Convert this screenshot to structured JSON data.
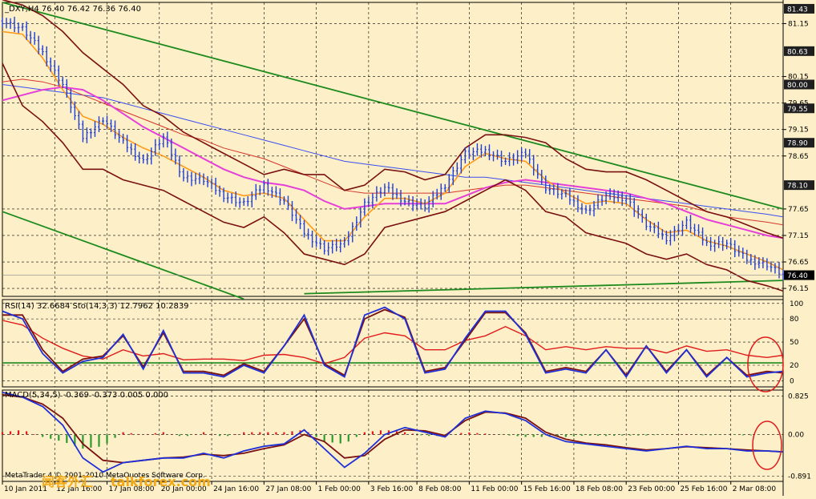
{
  "colors": {
    "background": "#fdf0c8",
    "price": "#1f3fd8",
    "price_up": "#1f3fd8",
    "price_down": "#1f3fd8",
    "fast_ma": "#ff9a1a",
    "fast_ma2": "#1ed1f0",
    "magenta_ma": "#e63fd9",
    "blue_ma": "#3a4df0",
    "red_ma": "#d6352a",
    "bollinger": "#7a1010",
    "trend_line": "#1d8a1d",
    "rsi": "#e11b1b",
    "stoch": "#1f2fd8",
    "stoch_signal": "#7a1010",
    "macd_pos": "#e11b1b",
    "macd_neg": "#2a9a2a",
    "grid": "#000000",
    "annotation_circle": "#e11b1b",
    "watermark": "#f2a915"
  },
  "chart_data": [
    {
      "type": "line",
      "panel": "price",
      "title": "_DXY,H4  76.40  76.42  76.36  76.40",
      "ylim": [
        76.0,
        81.55
      ],
      "y_tick_labels": [
        "81.15",
        "80.15",
        "79.65",
        "79.15",
        "78.65",
        "77.65",
        "77.15",
        "76.65",
        "76.15"
      ],
      "price_badges": [
        "81.43",
        "80.63",
        "80.00",
        "79.55",
        "78.90",
        "78.10",
        "76.40"
      ],
      "price_badge_values": [
        81.43,
        80.63,
        80.0,
        79.55,
        78.9,
        78.1,
        76.4
      ],
      "x_tick_labels": [
        "10 Jan 2011",
        "12 Jan 16:00",
        "17 Jan 08:00",
        "20 Jan 00:00",
        "24 Jan 16:00",
        "27 Jan 08:00",
        "1 Feb 00:00",
        "3 Feb 16:00",
        "8 Feb 08:00",
        "11 Feb 00:00",
        "15 Feb 16:00",
        "18 Feb 08:00",
        "23 Feb 00:00",
        "25 Feb 16:00",
        "2 Mar 08:00"
      ],
      "x_bar_count": 195,
      "series": [
        {
          "role": "close",
          "x": [
            0,
            5,
            10,
            15,
            20,
            25,
            30,
            35,
            40,
            45,
            50,
            55,
            60,
            65,
            70,
            75,
            80,
            85,
            90,
            95,
            100,
            105,
            110,
            115,
            120,
            125,
            130,
            135,
            140,
            145,
            150,
            155,
            160,
            165,
            170,
            175,
            180,
            185,
            190,
            194
          ],
          "values": [
            81.2,
            81.05,
            80.6,
            80.0,
            79.0,
            79.35,
            78.9,
            78.55,
            79.0,
            78.25,
            78.2,
            77.9,
            77.75,
            78.1,
            77.8,
            77.2,
            76.9,
            77.0,
            77.75,
            78.05,
            77.8,
            77.7,
            78.1,
            78.7,
            78.75,
            78.55,
            78.7,
            78.05,
            77.9,
            77.6,
            77.9,
            77.85,
            77.35,
            77.1,
            77.4,
            77.0,
            77.0,
            76.7,
            76.6,
            76.4
          ]
        },
        {
          "role": "fast_ma",
          "values": [
            81.0,
            80.95,
            80.5,
            79.9,
            79.4,
            79.25,
            79.0,
            78.8,
            78.65,
            78.45,
            78.25,
            78.0,
            77.9,
            77.95,
            77.85,
            77.45,
            77.05,
            77.05,
            77.5,
            77.85,
            77.85,
            77.75,
            77.95,
            78.45,
            78.7,
            78.6,
            78.55,
            78.2,
            77.95,
            77.75,
            77.8,
            77.75,
            77.45,
            77.2,
            77.25,
            77.05,
            76.95,
            76.8,
            76.65,
            76.5
          ]
        },
        {
          "role": "magenta_ma",
          "values": [
            79.7,
            79.8,
            79.9,
            79.95,
            79.9,
            79.7,
            79.45,
            79.2,
            79.0,
            78.8,
            78.6,
            78.4,
            78.25,
            78.15,
            78.1,
            78.0,
            77.8,
            77.65,
            77.7,
            77.75,
            77.75,
            77.75,
            77.75,
            77.9,
            78.05,
            78.15,
            78.2,
            78.15,
            78.1,
            78.05,
            78.0,
            77.95,
            77.85,
            77.75,
            77.6,
            77.45,
            77.35,
            77.25,
            77.15,
            77.1
          ]
        },
        {
          "role": "blue_ma",
          "values": [
            80.0,
            79.95,
            79.9,
            79.85,
            79.8,
            79.75,
            79.65,
            79.55,
            79.45,
            79.35,
            79.25,
            79.15,
            79.05,
            78.95,
            78.85,
            78.75,
            78.65,
            78.55,
            78.5,
            78.45,
            78.4,
            78.35,
            78.3,
            78.25,
            78.25,
            78.2,
            78.15,
            78.1,
            78.05,
            78.0,
            77.95,
            77.9,
            77.85,
            77.8,
            77.75,
            77.7,
            77.65,
            77.6,
            77.55,
            77.5
          ]
        },
        {
          "role": "red_ma",
          "values": [
            80.05,
            80.1,
            80.05,
            79.95,
            79.8,
            79.65,
            79.5,
            79.35,
            79.2,
            79.05,
            78.95,
            78.8,
            78.7,
            78.6,
            78.45,
            78.3,
            78.15,
            78.0,
            77.95,
            77.95,
            77.95,
            77.95,
            77.95,
            78.0,
            78.05,
            78.1,
            78.1,
            78.05,
            78.0,
            77.95,
            77.9,
            77.85,
            77.8,
            77.75,
            77.7,
            77.6,
            77.5,
            77.45,
            77.4,
            77.35
          ]
        },
        {
          "role": "boll_upper",
          "values": [
            81.6,
            81.5,
            81.3,
            81.0,
            80.6,
            80.3,
            80.0,
            79.6,
            79.4,
            79.1,
            78.9,
            78.7,
            78.5,
            78.3,
            78.4,
            78.3,
            78.3,
            78.0,
            78.1,
            78.4,
            78.35,
            78.2,
            78.3,
            78.8,
            79.05,
            79.05,
            79.0,
            78.9,
            78.6,
            78.4,
            78.35,
            78.35,
            78.2,
            78.0,
            77.8,
            77.6,
            77.5,
            77.35,
            77.2,
            77.1
          ]
        },
        {
          "role": "boll_lower",
          "values": [
            80.4,
            79.6,
            79.3,
            78.9,
            78.4,
            78.4,
            78.2,
            78.1,
            78.0,
            77.8,
            77.6,
            77.4,
            77.3,
            77.5,
            77.2,
            76.8,
            76.7,
            76.6,
            76.8,
            77.3,
            77.4,
            77.5,
            77.6,
            77.8,
            78.0,
            78.2,
            78.0,
            77.6,
            77.5,
            77.2,
            77.1,
            77.0,
            76.8,
            76.7,
            76.8,
            76.6,
            76.5,
            76.3,
            76.2,
            76.1
          ]
        }
      ],
      "trend_lines": [
        {
          "x": [
            0,
            194
          ],
          "values": [
            81.55,
            77.65
          ]
        },
        {
          "x": [
            0,
            60
          ],
          "values": [
            77.6,
            75.95
          ]
        },
        {
          "x": [
            75,
            194
          ],
          "values": [
            76.05,
            76.3
          ]
        }
      ]
    },
    {
      "type": "line",
      "panel": "oscillator",
      "title": "RSI(14) 32.6684  Sto(14,3,3) 12.7962 10.2839",
      "ylim": [
        -8,
        105
      ],
      "y_tick_labels": [
        "100",
        "80",
        "50",
        "20",
        "0"
      ],
      "reference_line": 23,
      "series": [
        {
          "name": "RSI(14)",
          "role": "rsi",
          "x": [
            0,
            5,
            10,
            15,
            20,
            25,
            30,
            35,
            40,
            45,
            50,
            55,
            60,
            65,
            70,
            75,
            80,
            85,
            90,
            95,
            100,
            105,
            110,
            115,
            120,
            125,
            130,
            135,
            140,
            145,
            150,
            155,
            160,
            165,
            170,
            175,
            180,
            185,
            190,
            194
          ],
          "values": [
            78,
            72,
            55,
            42,
            32,
            28,
            40,
            32,
            35,
            27,
            28,
            28,
            26,
            33,
            34,
            30,
            22,
            30,
            55,
            62,
            58,
            40,
            40,
            52,
            58,
            70,
            58,
            40,
            44,
            40,
            44,
            42,
            42,
            36,
            45,
            38,
            40,
            33,
            30,
            33
          ]
        },
        {
          "name": "Sto(14,3,3)",
          "role": "stoch",
          "values": [
            90,
            80,
            35,
            10,
            25,
            30,
            60,
            15,
            65,
            10,
            10,
            5,
            20,
            10,
            45,
            85,
            20,
            5,
            85,
            95,
            80,
            10,
            15,
            55,
            90,
            90,
            60,
            10,
            15,
            10,
            40,
            5,
            45,
            10,
            40,
            5,
            30,
            5,
            10,
            12
          ]
        },
        {
          "role": "stoch_signal",
          "values": [
            85,
            85,
            40,
            12,
            28,
            32,
            58,
            18,
            62,
            12,
            12,
            7,
            22,
            12,
            45,
            80,
            22,
            7,
            80,
            92,
            82,
            12,
            17,
            52,
            88,
            88,
            62,
            12,
            17,
            12,
            40,
            7,
            45,
            12,
            40,
            7,
            30,
            7,
            12,
            10
          ]
        }
      ]
    },
    {
      "type": "bar",
      "panel": "macd",
      "title": "MACD(5,34,5) -0.369 -0.373 0.005 0.000",
      "ylim": [
        -1.0,
        0.95
      ],
      "y_tick_labels": [
        "0.825",
        "0.00",
        "-0.891"
      ],
      "x": [
        0,
        5,
        10,
        15,
        20,
        25,
        30,
        35,
        40,
        45,
        50,
        55,
        60,
        65,
        70,
        75,
        80,
        85,
        90,
        95,
        100,
        105,
        110,
        115,
        120,
        125,
        130,
        135,
        140,
        145,
        150,
        155,
        160,
        165,
        170,
        175,
        180,
        185,
        190,
        194
      ],
      "series": [
        {
          "role": "macd_line",
          "values": [
            0.9,
            0.8,
            0.6,
            0.2,
            -0.5,
            -0.8,
            -0.6,
            -0.55,
            -0.5,
            -0.5,
            -0.4,
            -0.5,
            -0.35,
            -0.25,
            -0.2,
            0.1,
            -0.3,
            -0.7,
            -0.4,
            0.0,
            0.15,
            0.05,
            -0.05,
            0.35,
            0.5,
            0.45,
            0.3,
            0.0,
            -0.15,
            -0.2,
            -0.25,
            -0.3,
            -0.35,
            -0.3,
            -0.25,
            -0.3,
            -0.3,
            -0.35,
            -0.35,
            -0.37
          ]
        },
        {
          "role": "macd_signal",
          "values": [
            0.85,
            0.8,
            0.65,
            0.35,
            -0.2,
            -0.55,
            -0.6,
            -0.55,
            -0.5,
            -0.48,
            -0.42,
            -0.45,
            -0.4,
            -0.3,
            -0.22,
            0.0,
            -0.15,
            -0.5,
            -0.45,
            -0.1,
            0.1,
            0.08,
            -0.02,
            0.3,
            0.48,
            0.46,
            0.35,
            0.05,
            -0.1,
            -0.18,
            -0.22,
            -0.28,
            -0.33,
            -0.3,
            -0.26,
            -0.28,
            -0.3,
            -0.33,
            -0.35,
            -0.37
          ]
        },
        {
          "role": "histogram",
          "values": [
            0.05,
            0.1,
            -0.05,
            -0.15,
            -0.3,
            -0.25,
            0.05,
            0.0,
            0.05,
            -0.05,
            0.05,
            -0.05,
            0.05,
            0.05,
            0.05,
            0.1,
            -0.15,
            -0.2,
            0.05,
            0.1,
            0.05,
            -0.03,
            -0.03,
            0.05,
            0.02,
            -0.01,
            -0.05,
            -0.05,
            -0.05,
            -0.02,
            -0.03,
            -0.02,
            -0.02,
            0.0,
            0.01,
            -0.02,
            0.0,
            -0.02,
            0.0,
            0.005
          ]
        }
      ]
    }
  ],
  "watermark": {
    "left": "MetaTrader 4 © 2001-2010 MetaQuotes Software Corp.",
    "site_cn": "闻客外汇",
    "site": "talkforex.com"
  }
}
